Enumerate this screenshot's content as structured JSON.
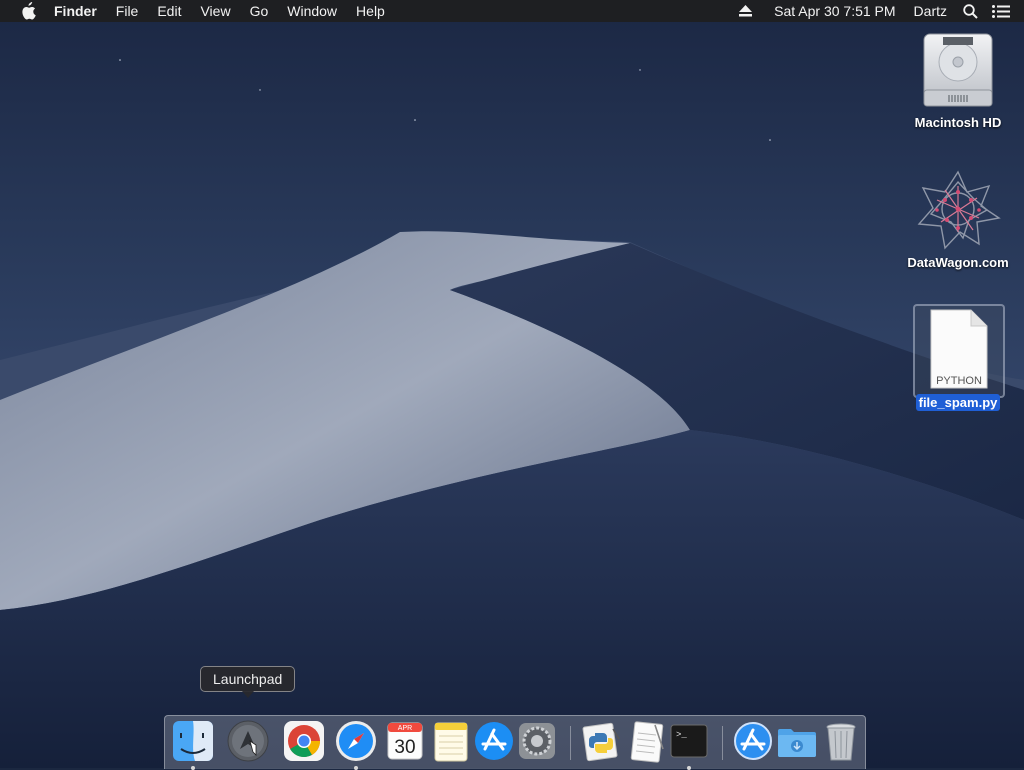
{
  "menubar": {
    "app_name": "Finder",
    "menus": [
      "File",
      "Edit",
      "View",
      "Go",
      "Window",
      "Help"
    ],
    "datetime": "Sat Apr 30  7:51 PM",
    "user": "Dartz",
    "icons": [
      "apple-icon",
      "eject-icon",
      "spotlight-icon",
      "notification-center-icon"
    ]
  },
  "desktop": {
    "icons": [
      {
        "label": "Macintosh HD",
        "icon": "hard-drive-icon",
        "selected": false
      },
      {
        "label": "DataWagon.com",
        "icon": "network-volume-icon",
        "selected": false
      },
      {
        "label": "file_spam.py",
        "icon": "python-file-icon",
        "selected": true,
        "file_type_text": "PYTHON"
      }
    ]
  },
  "dock": {
    "tooltip": "Launchpad",
    "items": [
      {
        "name": "Finder",
        "icon": "finder-icon",
        "running": true
      },
      {
        "name": "Launchpad",
        "icon": "launchpad-icon",
        "running": false
      },
      {
        "name": "Google Chrome",
        "icon": "chrome-icon",
        "running": false
      },
      {
        "name": "Safari",
        "icon": "safari-icon",
        "running": true
      },
      {
        "name": "Calendar",
        "icon": "calendar-icon",
        "running": false,
        "month": "APR",
        "day": "30"
      },
      {
        "name": "Notes",
        "icon": "notes-icon",
        "running": false
      },
      {
        "name": "App Store",
        "icon": "app-store-icon",
        "running": false
      },
      {
        "name": "System Preferences",
        "icon": "system-preferences-icon",
        "running": false
      },
      {
        "name": "Python Launcher",
        "icon": "python-launcher-icon",
        "running": false
      },
      {
        "name": "TextEdit",
        "icon": "textedit-icon",
        "running": false
      },
      {
        "name": "Terminal",
        "icon": "terminal-icon",
        "running": true,
        "prompt": ">_"
      },
      {
        "name": "Applications",
        "icon": "applications-folder-icon",
        "running": false
      },
      {
        "name": "Downloads",
        "icon": "downloads-folder-icon",
        "running": false
      },
      {
        "name": "Trash",
        "icon": "trash-icon",
        "running": false
      }
    ]
  },
  "colors": {
    "menubar_bg": "#1e1e20",
    "selection_blue": "#1f5fd6",
    "sky_top": "#1d2a45",
    "dune_light": "#8d98ae"
  }
}
